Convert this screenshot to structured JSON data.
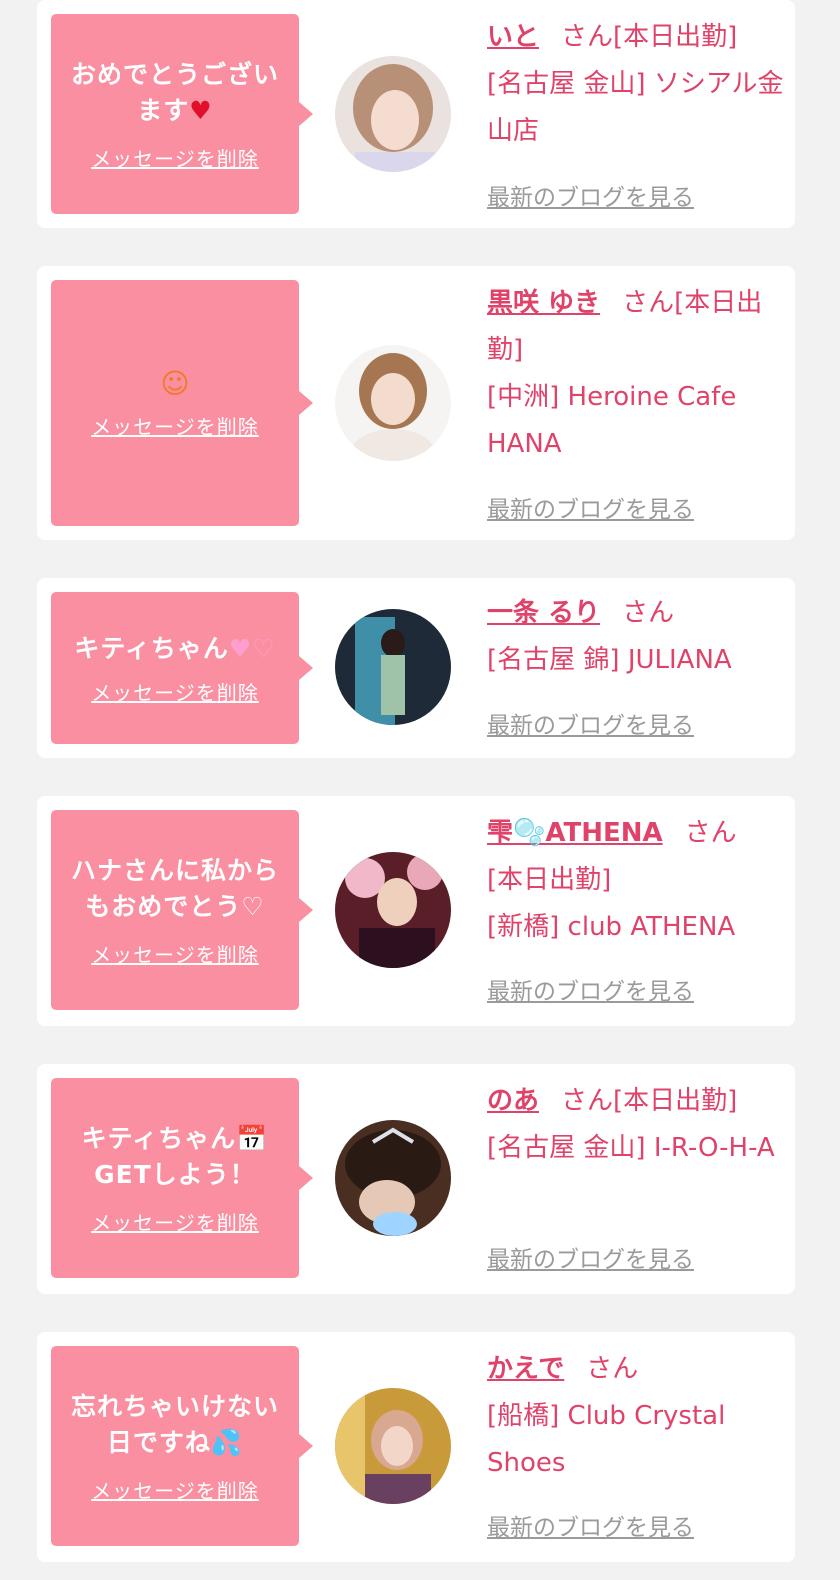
{
  "delete_label": "メッセージを削除",
  "blog_label": "最新のブログを見る",
  "san_label": "さん",
  "colors": {
    "background": "#f2f2f2",
    "bubble": "#f98fa0",
    "accent": "#e0436a",
    "link_gray": "#9a9a9a"
  },
  "items": [
    {
      "message_lines": [
        "おめでとうござい",
        "ます"
      ],
      "message_emoji": "♥",
      "name": "いと",
      "status": "[本日出勤]",
      "shop": "[名古屋 金山] ソシアル金山店"
    },
    {
      "message_lines": [],
      "message_emoji": "☺",
      "name": "黒咲 ゆき",
      "status": "[本日出勤]",
      "shop": "[中洲] Heroine Cafe HANA"
    },
    {
      "message_lines": [
        "キティちゃん"
      ],
      "message_emoji": "♥♡",
      "name": "一条 るり",
      "status": "",
      "shop": "[名古屋 錦] JULIANA"
    },
    {
      "message_lines": [
        "ハナさんに私から",
        "もおめでとう♡"
      ],
      "message_emoji": "",
      "name": "雫🫧ATHENA",
      "status": "[本日出勤]",
      "shop": "[新橋] club ATHENA"
    },
    {
      "message_lines": [
        "キティちゃん📅",
        "GETしよう！"
      ],
      "message_emoji": "",
      "name": "のあ",
      "status": "[本日出勤]",
      "shop": "[名古屋 金山] I-R-O-H-A"
    },
    {
      "message_lines": [
        "忘れちゃいけない",
        "日ですね💦"
      ],
      "message_emoji": "",
      "name": "かえで",
      "status": "",
      "shop": "[船橋] Club Crystal Shoes"
    }
  ]
}
